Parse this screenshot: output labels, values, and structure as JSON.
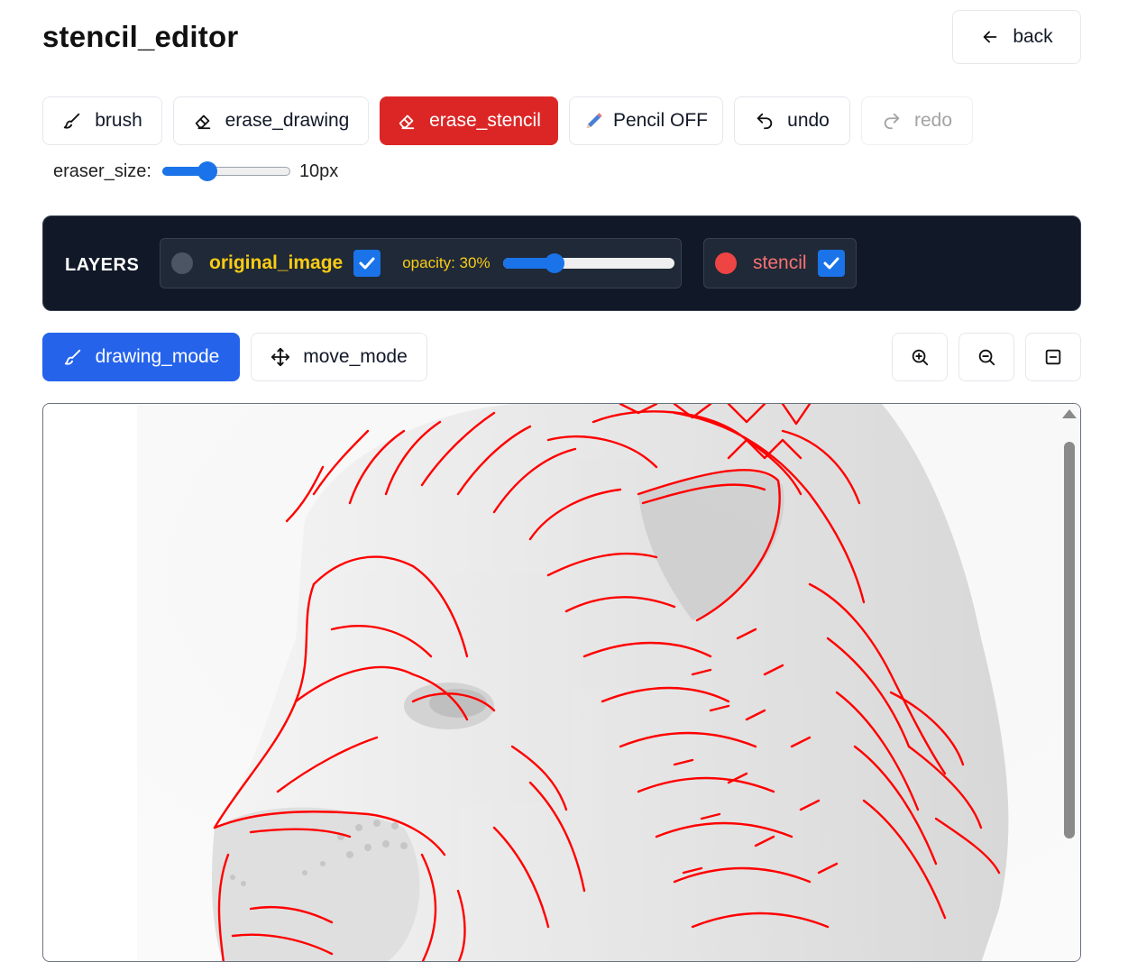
{
  "page": {
    "title": "stencil_editor",
    "back_label": "back"
  },
  "toolbar": {
    "brush": "brush",
    "erase_drawing": "erase_drawing",
    "erase_stencil": "erase_stencil",
    "pencil": "Pencil OFF",
    "undo": "undo",
    "redo": "redo",
    "eraser_size_label": "eraser_size:",
    "eraser_size_value": "10px",
    "eraser_size_fraction": 0.35
  },
  "layers": {
    "heading": "LAYERS",
    "original_image": {
      "name": "original_image",
      "checked": true,
      "opacity_label": "opacity: 30%",
      "opacity": 0.3
    },
    "stencil": {
      "name": "stencil",
      "checked": true
    }
  },
  "modes": {
    "drawing": "drawing_mode",
    "move": "move_mode"
  },
  "view_controls": [
    "zoom-in-icon",
    "zoom-out-icon",
    "fit-screen-icon"
  ],
  "colors": {
    "accent": "#2563eb",
    "danger": "#dc2626",
    "stencil_line": "#ff0000",
    "panel": "#111827",
    "yellow_label": "#facc15",
    "pink_label": "#f87171"
  }
}
